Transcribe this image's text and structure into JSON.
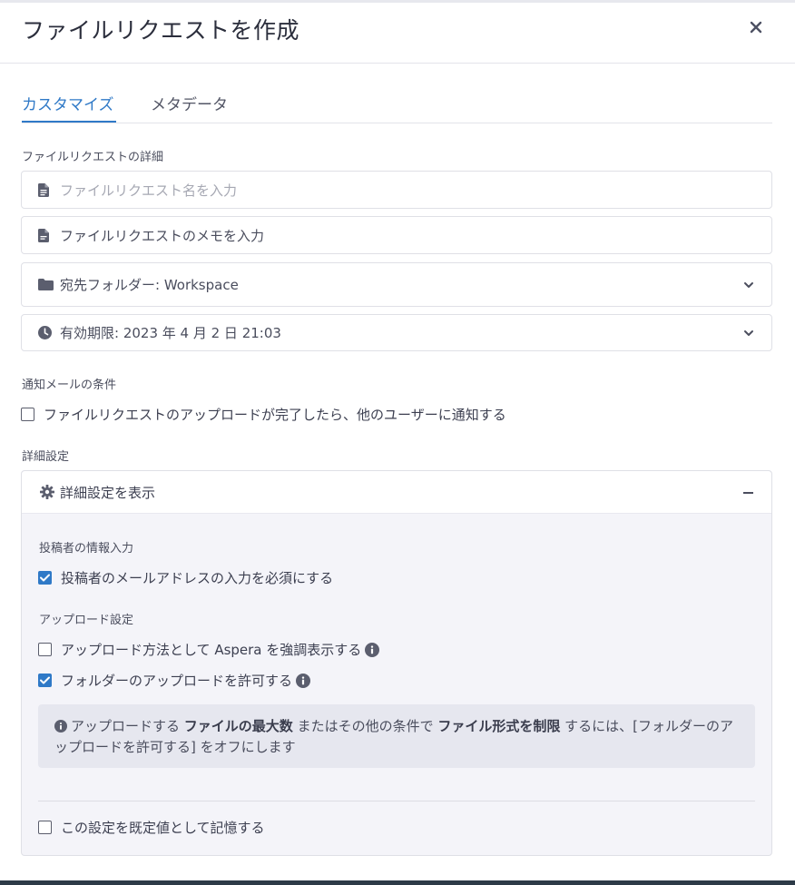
{
  "dialog": {
    "title": "ファイルリクエストを作成",
    "close_icon": "close-icon"
  },
  "tabs": [
    {
      "label": "カスタマイズ",
      "active": true
    },
    {
      "label": "メタデータ",
      "active": false
    }
  ],
  "details": {
    "section_label": "ファイルリクエストの詳細",
    "name_placeholder": "ファイルリクエスト名を入力",
    "memo_label": "ファイルリクエストのメモを入力",
    "folder_label": "宛先フォルダー: Workspace",
    "expiry_label": "有効期限: 2023 年 4 月 2 日 21:03"
  },
  "notification": {
    "section_label": "通知メールの条件",
    "notify_label": "ファイルリクエストのアップロードが完了したら、他のユーザーに通知する",
    "notify_checked": false
  },
  "advanced": {
    "section_label": "詳細設定",
    "toggle_label": "詳細設定を表示",
    "submitter_label": "投稿者の情報入力",
    "require_email_label": "投稿者のメールアドレスの入力を必須にする",
    "require_email_checked": true,
    "upload_label": "アップロード設定",
    "aspera_label": "アップロード方法として Aspera を強調表示する",
    "aspera_checked": false,
    "folders_label": "フォルダーのアップロードを許可する",
    "folders_checked": true,
    "note": {
      "p1": "アップロードする ",
      "b1": "ファイルの最大数",
      "p2": " またはその他の条件で ",
      "b2": "ファイル形式を制限",
      "p3": " するには、[フォルダーのアップロードを許可する] をオフにします"
    },
    "remember_label": "この設定を既定値として記憶する",
    "remember_checked": false
  },
  "colors": {
    "accent": "#2f79c7",
    "panel_bg": "#f4f4f9",
    "note_bg": "#e6e7ef"
  }
}
